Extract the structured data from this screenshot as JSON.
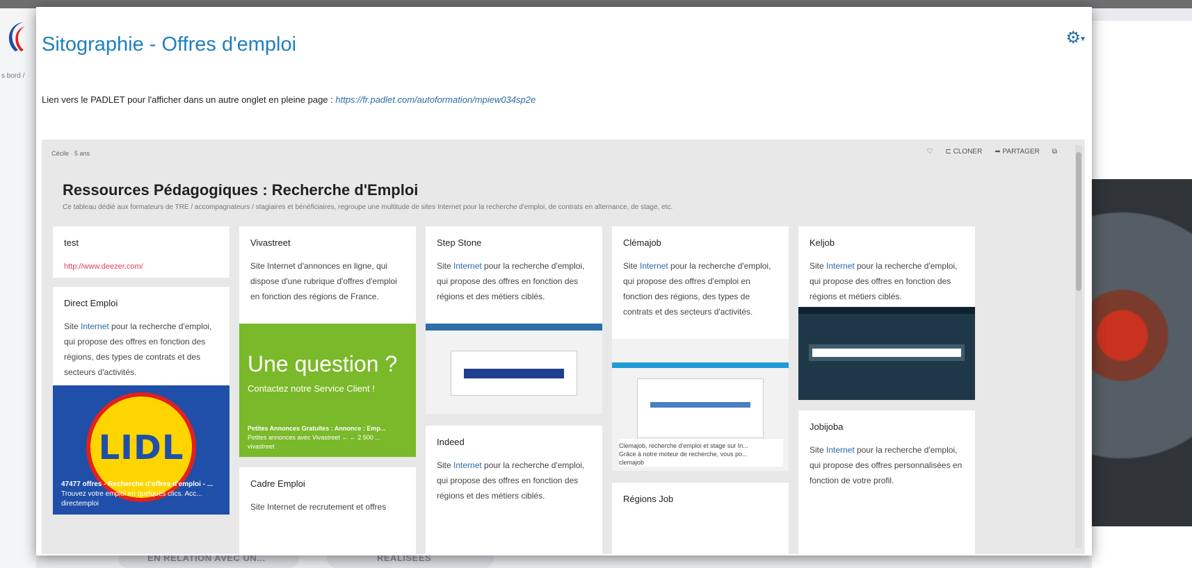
{
  "background": {
    "breadcrumb": "s bord  /",
    "bottom_left": "EN RELATION AVEC UN...",
    "bottom_right": "RÉALISÉES"
  },
  "modal": {
    "title": "Sitographie - Offres d'emploi",
    "gear_icon": "gear-icon",
    "link_prefix": "Lien vers le PADLET pour l'afficher dans un autre onglet en pleine page : ",
    "link_url": "https://fr.padlet.com/autoformation/mpiew034sp2e"
  },
  "padlet": {
    "user": "Cécile  ·  5 ans",
    "actions": {
      "like": "♡",
      "clone": "CLONER",
      "share": "PARTAGER",
      "open": "⧉"
    },
    "title": "Ressources Pédagogiques : Recherche d'Emploi",
    "description": "Ce tableau dédié aux formateurs de TRE / accompagnateurs / stagiaires et bénéficiaires, regroupe une multitude de sites Internet pour la recherche d'emploi, de contrats en alternance, de stage, etc.",
    "cards": {
      "test": {
        "title": "test",
        "link": "http://www.deezer.com/"
      },
      "direct_emploi": {
        "title": "Direct Emploi",
        "body_a": "Site ",
        "body_hl": "Internet",
        "body_b": " pour la recherche d'emploi, qui propose des offres en fonction des régions, des types de contrats et des secteurs d'activités."
      },
      "lidl": {
        "logo": "LIDL",
        "cap_title": "47477 offres - Recherche d'offres d'emploi - ...",
        "cap_line": "Trouvez votre emploi en quelques clics. Acc...",
        "cap_src": "directemploi"
      },
      "vivastreet": {
        "title": "Vivastreet",
        "body": "Site Internet d'annonces en ligne, qui dispose d'une rubrique d'offres d'emploi en fonction des régions de France."
      },
      "vivastreet_img": {
        "q": "Une question ?",
        "s": "Contactez notre Service Client !",
        "cap_title": "Petites Annonces Gratuites : Annonce : Emp...",
        "cap_line": "Petites annonces avec Vivastreet ← ← 2 500 ...",
        "cap_src": "vivastreet"
      },
      "cadre_emploi": {
        "title": "Cadre Emploi",
        "body": "Site Internet de recrutement et offres"
      },
      "step_stone": {
        "title": "Step Stone",
        "body_a": "Site ",
        "body_hl": "Internet",
        "body_b": " pour la recherche d'emploi, qui propose des offres en fonction des régions et des métiers ciblés."
      },
      "indeed": {
        "title": "Indeed",
        "body_a": "Site ",
        "body_hl": "Internet",
        "body_b": " pour la recherche d'emploi, qui propose des offres en fonction des régions et des métiers ciblés."
      },
      "clemajob": {
        "title": "Clémajob",
        "body_a": "Site ",
        "body_hl": "Internet",
        "body_b": " pour la recherche d'emploi, qui propose des offres d'emploi en fonction des régions, des types de contrats et des secteurs d'activités.",
        "cap_title": "Clemajob, recherche d'emploi et stage sur In...",
        "cap_line": "Grâce à notre moteur de recherche, vous po...",
        "cap_src": "clemajob"
      },
      "regions_job": {
        "title": "Régions Job"
      },
      "keljob": {
        "title": "Keljob",
        "body_a": "Site ",
        "body_hl": "Internet",
        "body_b": " pour la recherche d'emploi, qui propose des offres en fonction des régions et métiers ciblés."
      },
      "jobijoba": {
        "title": "Jobijoba",
        "body_a": "Site ",
        "body_hl": "Internet",
        "body_b": " pour la recherche d'emploi, qui propose des offres personnalisées en fonction de votre profil."
      }
    }
  }
}
